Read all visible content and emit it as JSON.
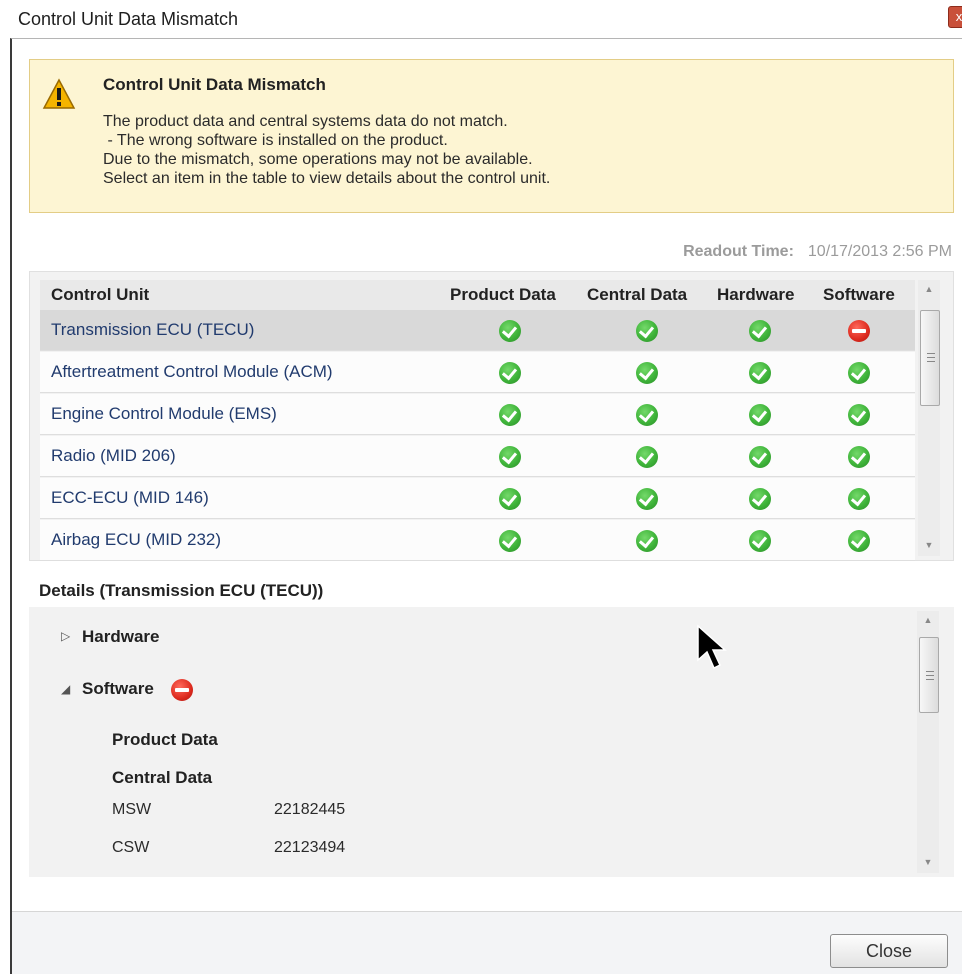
{
  "window": {
    "title": "Control Unit Data Mismatch",
    "close_glyph": "x"
  },
  "warning": {
    "icon": "warning-icon",
    "title": "Control Unit Data Mismatch",
    "lines": [
      "The product data and central systems data do not match.",
      " - The wrong software is installed on the product.",
      "Due to the mismatch, some operations may not be available.",
      "Select an item in the table to view details about the control unit."
    ]
  },
  "readout": {
    "label": "Readout Time:",
    "value": "10/17/2013 2:56 PM"
  },
  "table": {
    "columns": [
      "Control Unit",
      "Product Data",
      "Central Data",
      "Hardware",
      "Software"
    ],
    "rows": [
      {
        "name": "Transmission ECU (TECU)",
        "product_data": "ok",
        "central_data": "ok",
        "hardware": "ok",
        "software": "error"
      },
      {
        "name": "Aftertreatment Control Module (ACM)",
        "product_data": "ok",
        "central_data": "ok",
        "hardware": "ok",
        "software": "ok"
      },
      {
        "name": "Engine Control Module (EMS)",
        "product_data": "ok",
        "central_data": "ok",
        "hardware": "ok",
        "software": "ok"
      },
      {
        "name": "Radio (MID 206)",
        "product_data": "ok",
        "central_data": "ok",
        "hardware": "ok",
        "software": "ok"
      },
      {
        "name": "ECC-ECU (MID 146)",
        "product_data": "ok",
        "central_data": "ok",
        "hardware": "ok",
        "software": "ok"
      },
      {
        "name": "Airbag ECU (MID 232)",
        "product_data": "ok",
        "central_data": "ok",
        "hardware": "ok",
        "software": "ok"
      }
    ],
    "selected_row": "Transmission ECU (TECU)",
    "status_colors": {
      "ok": "#3fb43a",
      "error": "#dd2a1e"
    }
  },
  "details": {
    "title": "Details (Transmission ECU (TECU))",
    "hardware": {
      "label": "Hardware",
      "expanded": false
    },
    "software": {
      "label": "Software",
      "status": "error",
      "expanded": true,
      "product_data_label": "Product Data",
      "central_data_label": "Central Data",
      "items": [
        {
          "key": "MSW",
          "value": "22182445"
        },
        {
          "key": "CSW",
          "value": "22123494"
        }
      ]
    }
  },
  "footer": {
    "close_label": "Close"
  }
}
